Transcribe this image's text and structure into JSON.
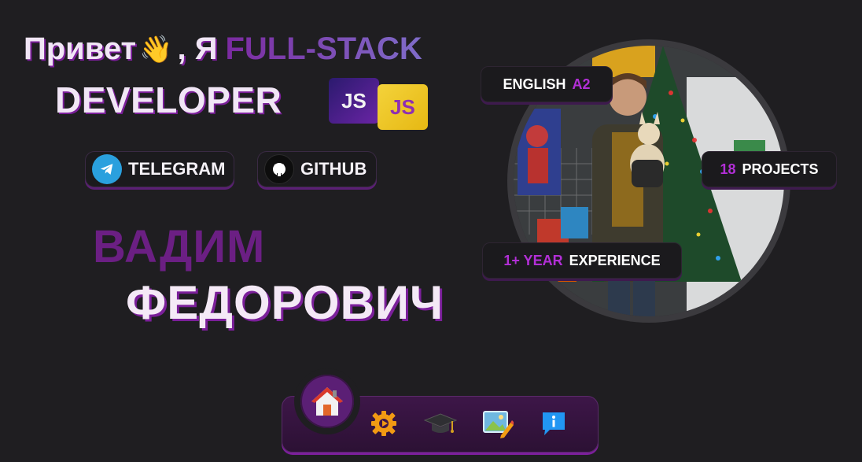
{
  "hero": {
    "greeting": "Привет",
    "wave_emoji": "👋",
    "separator": ", Я",
    "role_highlight": "FULL-STACK",
    "role_rest": "DEVELOPER"
  },
  "badges": {
    "js_dark": "JS",
    "js_yellow": "JS"
  },
  "social": {
    "telegram_label": "TELEGRAM",
    "github_label": "GITHUB"
  },
  "name": {
    "first": "ВАДИМ",
    "last": "ФЕДОРОВИЧ"
  },
  "chips": {
    "english_label": "ENGLISH",
    "english_level": "A2",
    "projects_count": "18",
    "projects_label": "PROJECTS",
    "experience_value": "1+ YEAR",
    "experience_label": "EXPERIENCE"
  },
  "nav": {
    "items": [
      {
        "icon": "home-icon"
      },
      {
        "icon": "gear-icon"
      },
      {
        "icon": "graduation-cap-icon"
      },
      {
        "icon": "picture-edit-icon"
      },
      {
        "icon": "info-icon"
      }
    ]
  },
  "colors": {
    "background": "#1f1e21",
    "accent_purple": "#7b1f9a",
    "name_purple": "#6b1f83",
    "chip_accent": "#b22fd6",
    "telegram_blue": "#2aa0de",
    "js_yellow": "#f4d33b"
  }
}
